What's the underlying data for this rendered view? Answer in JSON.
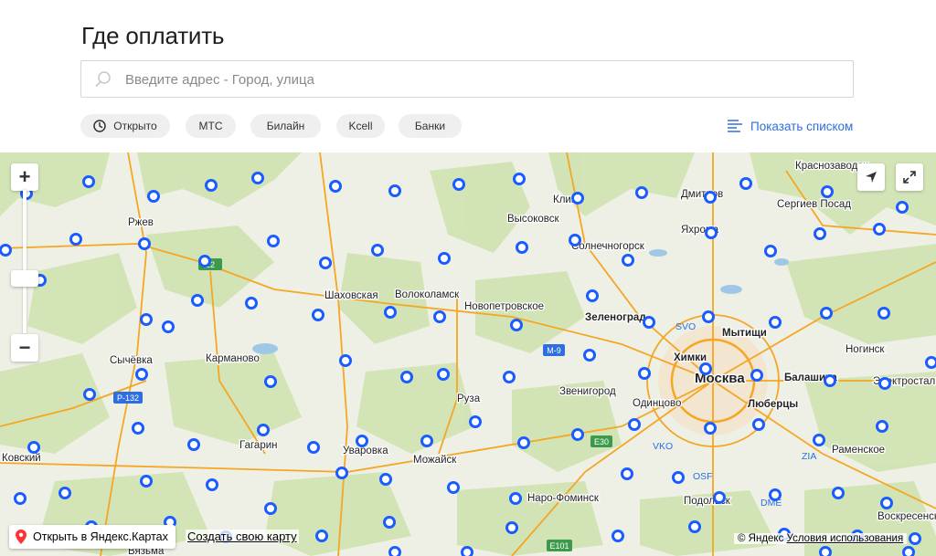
{
  "header": {
    "title": "Где оплатить"
  },
  "search": {
    "placeholder": "Введите адрес - Город, улица",
    "value": ""
  },
  "filters": [
    {
      "label": "Открыто",
      "icon": "clock-icon"
    },
    {
      "label": "МТС"
    },
    {
      "label": "Билайн"
    },
    {
      "label": "Kcell"
    },
    {
      "label": "Банки"
    }
  ],
  "list_toggle": {
    "label": "Показать списком",
    "icon": "list-icon"
  },
  "map": {
    "zoom_in": "+",
    "zoom_out": "−",
    "open_in_yandex": "Открыть в Яндекс.Картах",
    "create_map": "Создать свою карту",
    "copyright": "© Яндекс",
    "terms": "Условия использования",
    "colors": {
      "marker": "#1a5cff",
      "road": "#f5a623",
      "forest": "#cfe3b0",
      "water": "#9fc7e6"
    },
    "cities": [
      "Краснозаводск",
      "Дмитров",
      "Сергиев Посад",
      "Клин",
      "Высоковск",
      "Яхрома",
      "Ржев",
      "Солнечногорск",
      "Шаховская",
      "Волоколамск",
      "Новопетровское",
      "Зеленоград",
      "Мытищи",
      "Ногинск",
      "Сычёвка",
      "Карманово",
      "Химки",
      "Москва",
      "Балашиха",
      "Электросталь",
      "Руза",
      "Звенигород",
      "Одинцово",
      "Люберцы",
      "Гагарин",
      "Уваровка",
      "Можайск",
      "Раменское",
      "Наро-Фоминск",
      "Подольск",
      "Воскресенск",
      "Вязьма",
      "Ковский"
    ],
    "road_labels": [
      "M-9",
      "P-132",
      "E30",
      "E101",
      "22"
    ],
    "airports": [
      "SVO",
      "VKO",
      "OSF",
      "DME",
      "ZIA"
    ]
  }
}
